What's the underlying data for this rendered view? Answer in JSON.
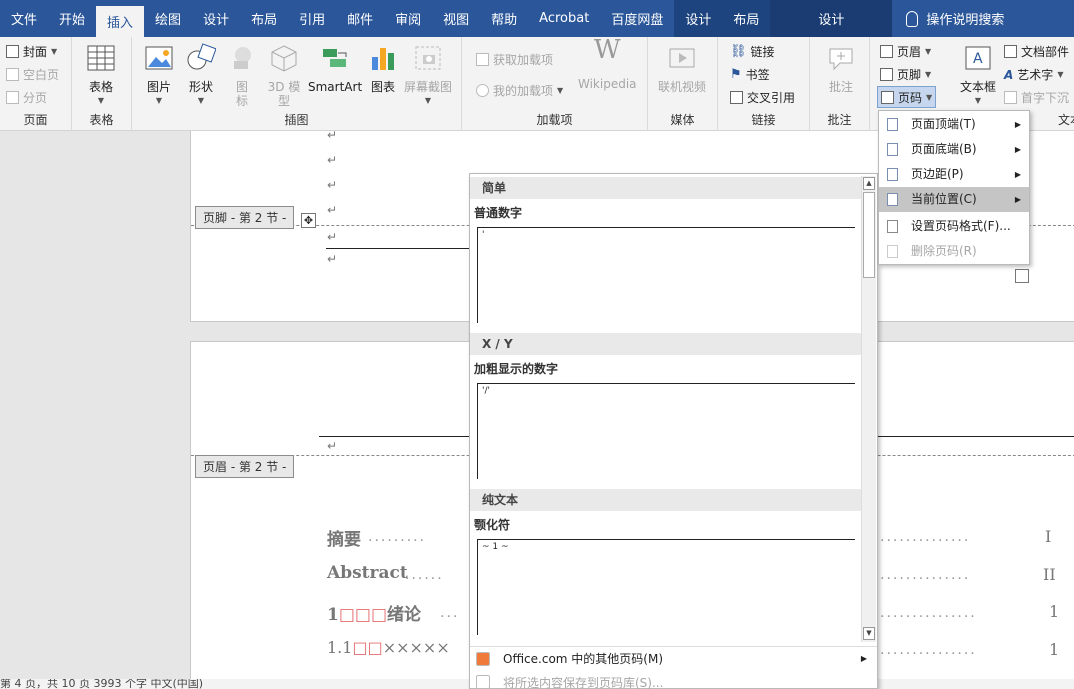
{
  "tabs": [
    "文件",
    "开始",
    "插入",
    "绘图",
    "设计",
    "布局",
    "引用",
    "邮件",
    "审阅",
    "视图",
    "帮助",
    "Acrobat",
    "百度网盘"
  ],
  "active_tab": "插入",
  "context_tabs": [
    "设计",
    "布局"
  ],
  "context_tab2": "设计",
  "tell_me": "操作说明搜索",
  "ribbon": {
    "page": {
      "label": "页面",
      "items": [
        "封面",
        "空白页",
        "分页"
      ]
    },
    "table": {
      "label": "表格",
      "button": "表格"
    },
    "illustrations": {
      "label": "插图",
      "buttons": [
        "图片",
        "形状",
        "图标",
        "3D 模型",
        "SmartArt",
        "图表",
        "屏幕截图"
      ]
    },
    "addins": {
      "label": "加载项",
      "get": "获取加载项",
      "my": "我的加载项",
      "wiki": "Wikipedia"
    },
    "media": {
      "label": "媒体",
      "button": "联机视频"
    },
    "links": {
      "label": "链接",
      "items": [
        "链接",
        "书签",
        "交叉引用"
      ]
    },
    "comments": {
      "label": "批注",
      "button": "批注"
    },
    "headerfooter": {
      "items": [
        "页眉",
        "页脚",
        "页码"
      ]
    },
    "text": {
      "textbox": "文本框",
      "items": [
        "文档部件",
        "艺术字",
        "首字下沉"
      ],
      "label_partial": "文本"
    }
  },
  "doc": {
    "footer_label": "页脚 - 第 2 节 -",
    "header_label": "页眉 - 第 2 节 -",
    "para_mark": "↵",
    "toc": [
      {
        "text": "摘要",
        "page": "I"
      },
      {
        "text": "Abstract",
        "page": "II"
      },
      {
        "num": "1",
        "boxes": "□□□",
        "title": "绪论",
        "page": "1"
      },
      {
        "num": "1.1",
        "boxes": "□□",
        "title": "×××××",
        "page": "1"
      }
    ]
  },
  "gallery": {
    "sections": [
      {
        "header": "简单",
        "name": "普通数字",
        "preview": "'"
      },
      {
        "header": "X / Y",
        "name": "加粗显示的数字",
        "preview": "'/'"
      },
      {
        "header": "纯文本",
        "name": "颚化符",
        "preview": "~ 1 ~"
      }
    ],
    "footer_more": "Office.com 中的其他页码(M)",
    "footer_save": "将所选内容保存到页码库(S)..."
  },
  "menu": {
    "items": [
      {
        "label": "页面顶端(T)",
        "arrow": true
      },
      {
        "label": "页面底端(B)",
        "arrow": true
      },
      {
        "label": "页边距(P)",
        "arrow": true
      },
      {
        "label": "当前位置(C)",
        "arrow": true,
        "highlight": true
      },
      {
        "label": "设置页码格式(F)...",
        "arrow": false
      },
      {
        "label": "删除页码(R)",
        "arrow": false,
        "disabled": true
      }
    ]
  },
  "statusbar": "第 4 页，共 10 页    3993 个字    中文(中国)",
  "colors": {
    "ribbon_blue": "#2b579a",
    "ribbon_bg": "#f3f3f3",
    "menu_highlight": "#c5c5c5"
  }
}
